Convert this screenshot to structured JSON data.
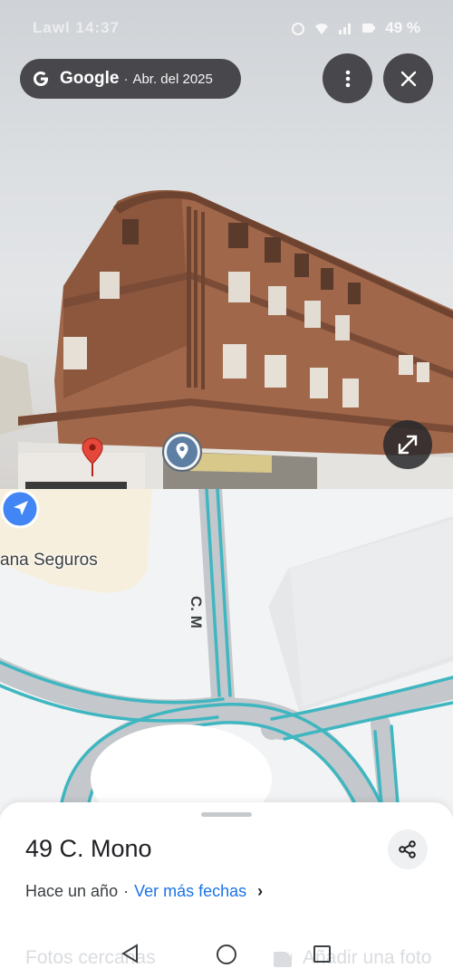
{
  "status_bar": {
    "time": "Lawl 14:37",
    "battery": "49 %"
  },
  "header": {
    "brand": "Google",
    "separator": "·",
    "capture_date": "Abr. del 2025",
    "more_icon": "more-vert-icon",
    "close_icon": "close-icon"
  },
  "photo": {
    "expand_icon": "expand-icon"
  },
  "map": {
    "poi_label": "ana Seguros",
    "street_label": "C. M",
    "road_color": "#c4c8cc",
    "route_color": "#3fb6c0",
    "location_color": "#4285f4"
  },
  "place": {
    "title": "49 C. Mono",
    "date_text": "Hace un año",
    "date_separator": "·",
    "more_dates_link": "Ver más fechas",
    "share_icon": "share-icon"
  },
  "actions": {
    "nearby_photos": "Fotos cercanas",
    "add_photo": "Añadir una foto"
  },
  "nav_bar": {
    "back_icon": "back-icon",
    "home_icon": "home-icon",
    "recent_icon": "recent-apps-icon"
  }
}
